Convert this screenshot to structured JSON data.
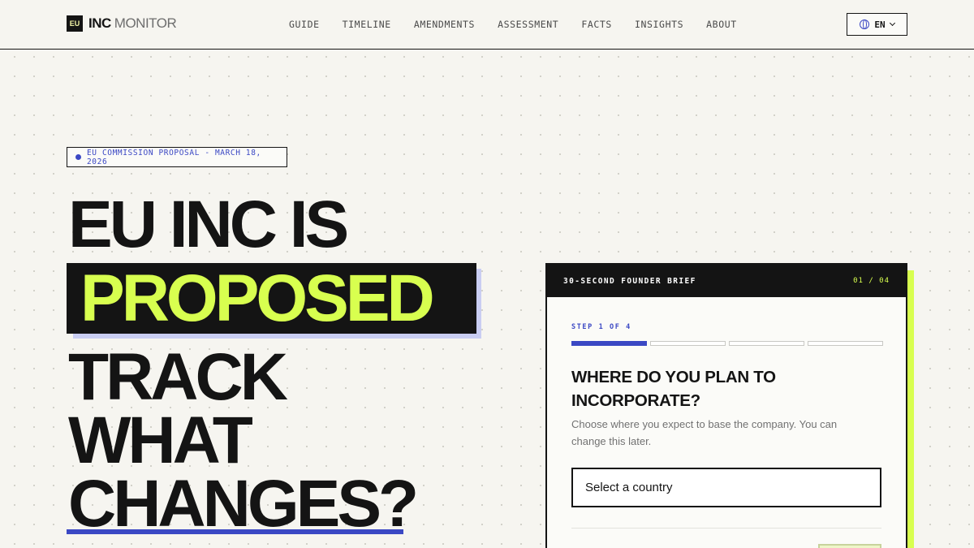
{
  "brand": {
    "badge": "EU",
    "name_strong": "INC",
    "name_light": "MONITOR"
  },
  "nav": {
    "items": [
      "GUIDE",
      "TIMELINE",
      "AMENDMENTS",
      "ASSESSMENT",
      "FACTS",
      "INSIGHTS",
      "ABOUT"
    ]
  },
  "language": {
    "current": "EN",
    "icon": "globe-icon"
  },
  "hero": {
    "badge_text": "EU COMMISSION PROPOSAL - MARCH 18, 2026",
    "line1": "EU INC IS",
    "highlight": "PROPOSED",
    "line3": "TRACK",
    "line4": "WHAT",
    "line5": "CHANGES?"
  },
  "brief": {
    "title": "30-SECOND FOUNDER BRIEF",
    "step_count": "01 / 04",
    "step_label": "STEP 1 OF 4",
    "progress": {
      "current": 1,
      "total": 4
    },
    "question": "WHERE DO YOU PLAN TO INCORPORATE?",
    "helper": "Choose where you expect to base the company. You can change this later.",
    "select_placeholder": "Select a country"
  },
  "colors": {
    "accent_blue": "#3b48c4",
    "accent_lime": "#d8ff4f",
    "ink": "#141414",
    "background": "#f6f5f0"
  }
}
